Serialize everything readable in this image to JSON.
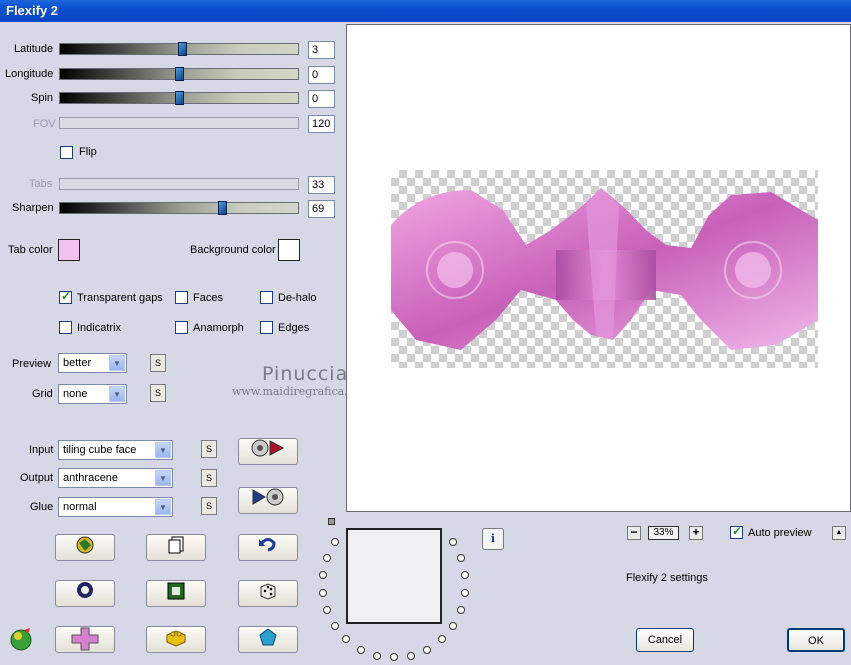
{
  "window": {
    "title": "Flexify 2"
  },
  "sliders": [
    {
      "label": "Latitude",
      "value": "3",
      "level": 0.52,
      "enabled": true
    },
    {
      "label": "Longitude",
      "value": "0",
      "level": 0.5,
      "enabled": true
    },
    {
      "label": "Spin",
      "value": "0",
      "level": 0.5,
      "enabled": true
    },
    {
      "label": "FOV",
      "value": "120",
      "level": null,
      "enabled": false
    },
    {
      "label": "Tabs",
      "value": "33",
      "level": null,
      "enabled": false
    },
    {
      "label": "Sharpen",
      "value": "69",
      "level": 0.69,
      "enabled": true
    }
  ],
  "flip": {
    "label": "Flip",
    "checked": false
  },
  "colors": {
    "tab_label": "Tab color",
    "tab_value": "#f4c2ec",
    "bg_label": "Background color",
    "bg_value": "#ffffff"
  },
  "options": {
    "transparent_gaps": {
      "label": "Transparent gaps",
      "checked": true
    },
    "faces": {
      "label": "Faces",
      "checked": false
    },
    "de_halo": {
      "label": "De-halo",
      "checked": false
    },
    "indicatrix": {
      "label": "Indicatrix",
      "checked": false
    },
    "anamorph": {
      "label": "Anamorph",
      "checked": false
    },
    "edges": {
      "label": "Edges",
      "checked": false
    }
  },
  "selects": {
    "preview": {
      "label": "Preview",
      "value": "better"
    },
    "grid": {
      "label": "Grid",
      "value": "none"
    },
    "input": {
      "label": "Input",
      "value": "tiling cube face"
    },
    "output": {
      "label": "Output",
      "value": "anthracene"
    },
    "glue": {
      "label": "Glue",
      "value": "normal"
    }
  },
  "small_button_label": "S",
  "watermark": {
    "name": "Pinuccia",
    "url": "www.maidiregrafica.eu"
  },
  "zoom": "33%",
  "auto_preview": {
    "label": "Auto preview",
    "checked": true
  },
  "settings_text": "Flexify 2 settings",
  "cancel_label": "Cancel",
  "ok_label": "OK",
  "info_label": "i",
  "scroll_up": "▲",
  "dropdown_arrow": "▼",
  "zoom_minus": "−",
  "zoom_plus": "+"
}
